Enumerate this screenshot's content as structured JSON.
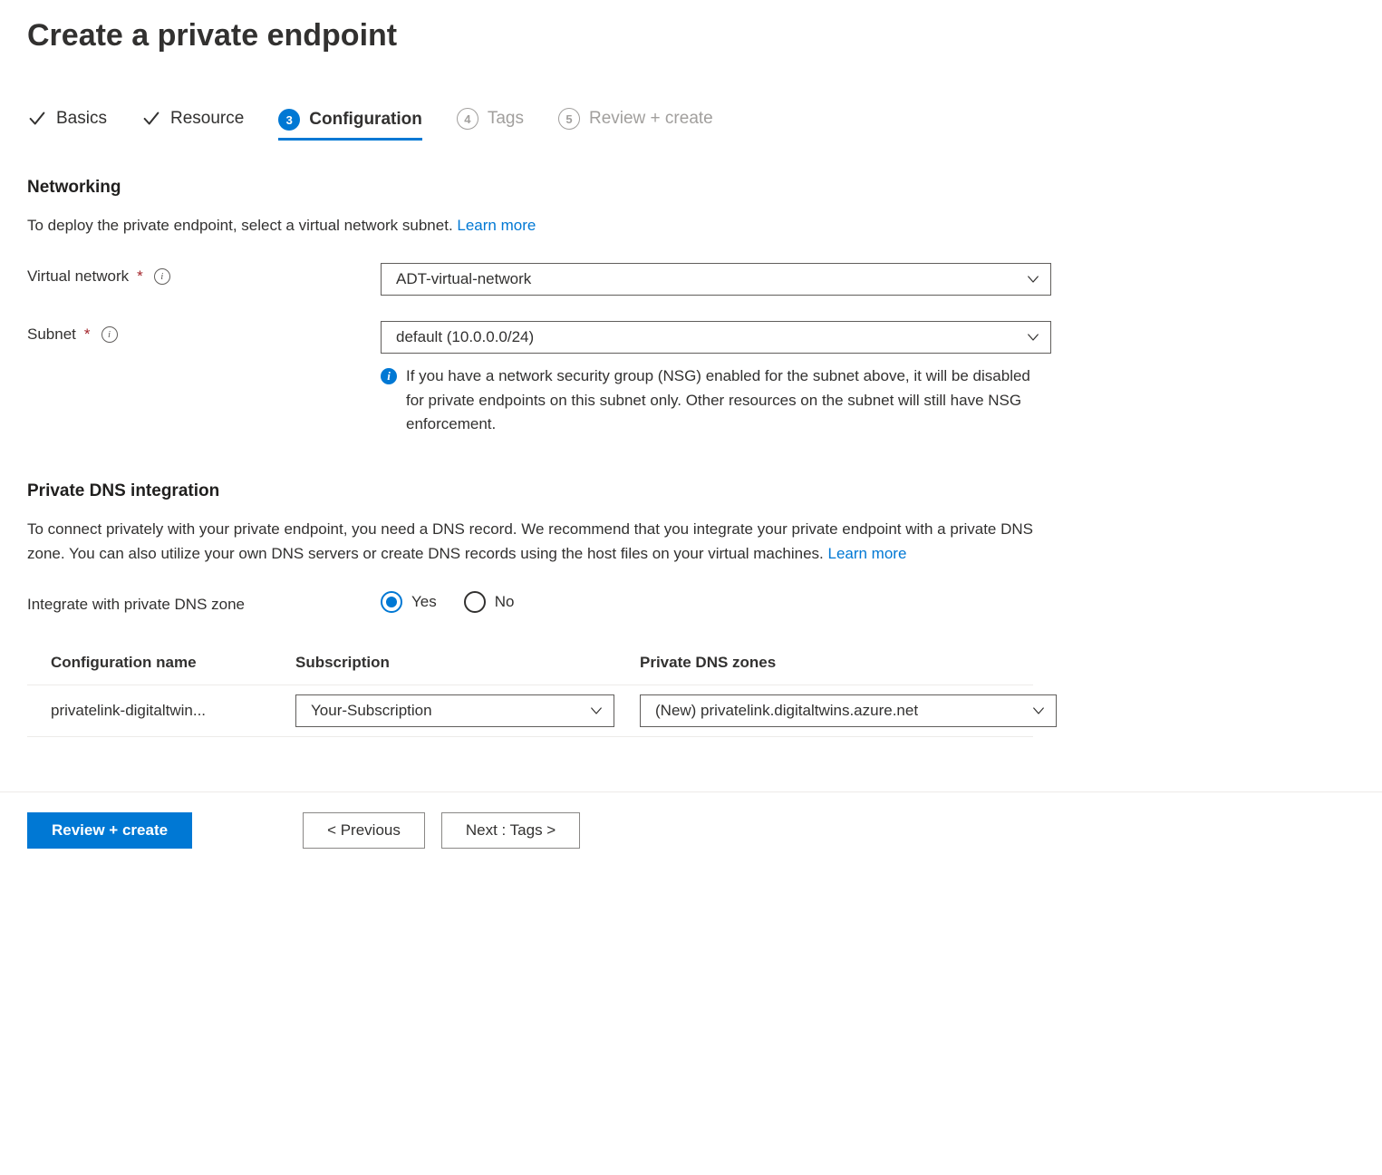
{
  "page": {
    "title": "Create a private endpoint"
  },
  "tabs": {
    "t1": {
      "label": "Basics"
    },
    "t2": {
      "label": "Resource"
    },
    "t3": {
      "label": "Configuration",
      "step": "3"
    },
    "t4": {
      "label": "Tags",
      "step": "4"
    },
    "t5": {
      "label": "Review + create",
      "step": "5"
    }
  },
  "networking": {
    "title": "Networking",
    "desc": "To deploy the private endpoint, select a virtual network subnet. ",
    "learn": "Learn more",
    "vnet_label": "Virtual network",
    "vnet_value": "ADT-virtual-network",
    "subnet_label": "Subnet",
    "subnet_value": "default (10.0.0.0/24)",
    "note": "If you have a network security group (NSG) enabled for the subnet above, it will be disabled for private endpoints on this subnet only. Other resources on the subnet will still have NSG enforcement."
  },
  "dns": {
    "title": "Private DNS integration",
    "desc": "To connect privately with your private endpoint, you need a DNS record. We recommend that you integrate your private endpoint with a private DNS zone. You can also utilize your own DNS servers or create DNS records using the host files on your virtual machines. ",
    "learn": "Learn more",
    "integrate_label": "Integrate with private DNS zone",
    "yes": "Yes",
    "no": "No",
    "col1": "Configuration name",
    "col2": "Subscription",
    "col3": "Private DNS zones",
    "row": {
      "config_name": "privatelink-digitaltwin...",
      "subscription": "Your-Subscription",
      "zone": "(New) privatelink.digitaltwins.azure.net"
    }
  },
  "footer": {
    "review": "Review + create",
    "prev": "< Previous",
    "next": "Next : Tags >"
  }
}
